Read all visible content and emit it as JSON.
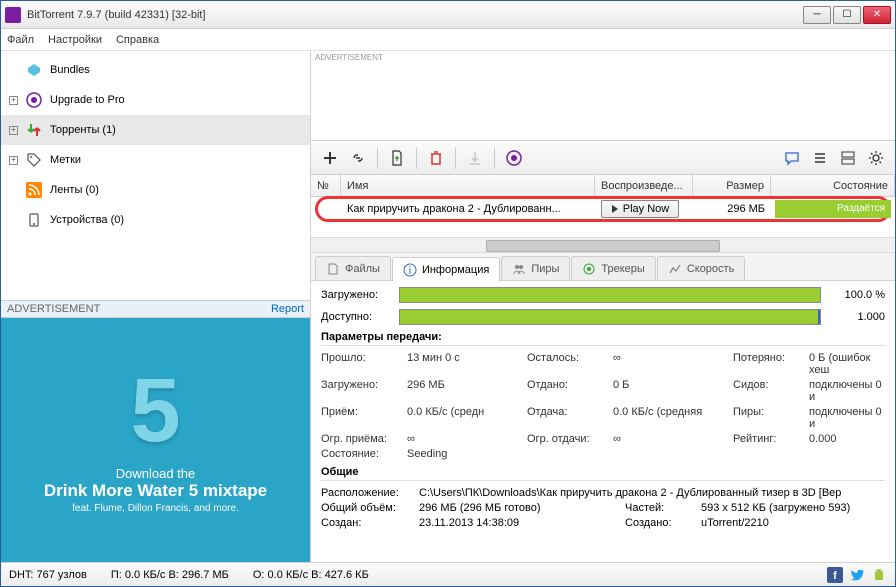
{
  "title": "BitTorrent 7.9.7  (build 42331) [32-bit]",
  "menu": {
    "file": "Файл",
    "settings": "Настройки",
    "help": "Справка"
  },
  "sidebar": {
    "bundles": "Bundles",
    "upgrade": "Upgrade to Pro",
    "torrents": "Торренты (1)",
    "labels": "Метки",
    "feeds": "Ленты (0)",
    "devices": "Устройства (0)",
    "ad_label": "ADVERTISEMENT",
    "ad_report": "Report",
    "ad_line1": "Download the",
    "ad_line2": "Drink More Water 5 mixtape",
    "ad_line3": "feat. Flume, Dillon Francis, and more."
  },
  "topad_label": "ADVERTISEMENT",
  "grid": {
    "headers": {
      "num": "№",
      "name": "Имя",
      "play": "Воспроизведе...",
      "size": "Размер",
      "status": "Состояние"
    },
    "row": {
      "name": "Как приручить дракона 2 - Дублированн...",
      "play": "Play Now",
      "size": "296 МБ",
      "status": "Раздаётся"
    }
  },
  "tabs": {
    "files": "Файлы",
    "info": "Информация",
    "peers": "Пиры",
    "trackers": "Трекеры",
    "speed": "Скорость"
  },
  "detail": {
    "downloaded": "Загружено:",
    "downloaded_pct": "100.0 %",
    "available": "Доступно:",
    "available_val": "1.000",
    "transfer_title": "Параметры передачи:",
    "elapsed_k": "Прошло:",
    "elapsed_v": "13 мин 0 с",
    "remaining_k": "Осталось:",
    "remaining_v": "∞",
    "wasted_k": "Потеряно:",
    "wasted_v": "0 Б (ошибок хеш",
    "down_k": "Загружено:",
    "down_v": "296 МБ",
    "up_k": "Отдано:",
    "up_v": "0 Б",
    "seeds_k": "Сидов:",
    "seeds_v": "подключены 0 и",
    "dlspeed_k": "Приём:",
    "dlspeed_v": "0.0 КБ/с (средн",
    "ulspeed_k": "Отдача:",
    "ulspeed_v": "0.0 КБ/с (средняя",
    "peers_k": "Пиры:",
    "peers_v": "подключены 0 и",
    "dllimit_k": "Огр. приёма:",
    "dllimit_v": "∞",
    "ullimit_k": "Огр. отдачи:",
    "ullimit_v": "∞",
    "ratio_k": "Рейтинг:",
    "ratio_v": "0.000",
    "state_k": "Состояние:",
    "state_v": "Seeding",
    "general_title": "Общие",
    "path_k": "Расположение:",
    "path_v": "C:\\Users\\ПК\\Downloads\\Как приручить дракона 2 - Дублированный тизер в 3D [Вер",
    "total_k": "Общий объём:",
    "total_v": "296 МБ (296 МБ готово)",
    "pieces_k": "Частей:",
    "pieces_v": "593 x 512 КБ (загружено 593)",
    "created_k": "Создан:",
    "created_v": "23.11.2013 14:38:09",
    "createdby_k": "Создано:",
    "createdby_v": "uTorrent/2210"
  },
  "status": {
    "dht": "DHT: 767 узлов",
    "dl": "П: 0.0 КБ/с В: 296.7 МБ",
    "ul": "О: 0.0 КБ/с В: 427.6 КБ"
  }
}
